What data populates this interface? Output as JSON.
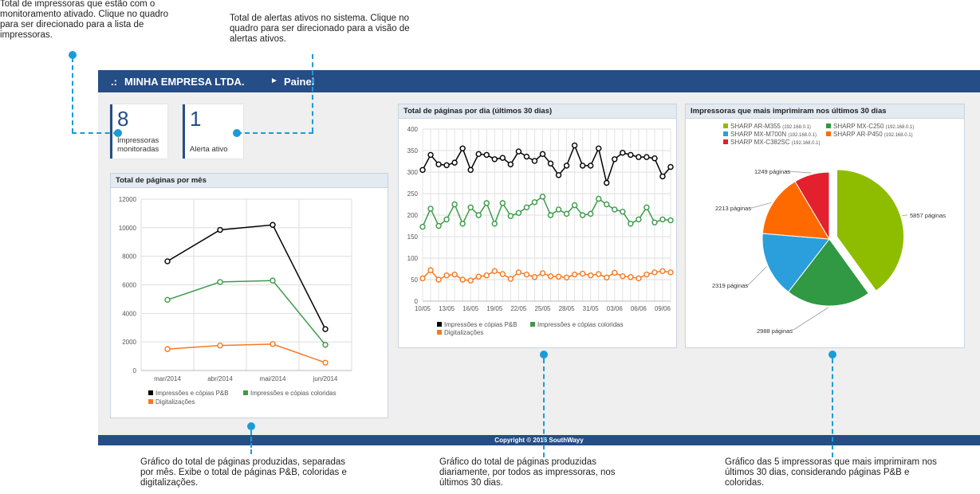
{
  "annotations": {
    "printers": "Total de impressoras que estão com o monitoramento ativado. Clique no quadro para ser direcionado para a lista de impressoras.",
    "alerts": "Total de alertas ativos no sistema. Clique no quadro para ser direcionado para a visão de alertas ativos.",
    "monthly": "Gráfico do total de páginas produzidas, separadas por mês. Exibe o total de páginas P&B, coloridas e digitalizações.",
    "daily": "Gráfico do total de páginas produzidas diariamente, por todos as impressoras, nos últimos 30 dias.",
    "top": "Gráfico das 5 impressoras que mais imprimiram nos últimos 30 dias, considerando páginas P&B e coloridas."
  },
  "header": {
    "prefix": ".:",
    "company": "MINHA EMPRESA LTDA.",
    "arrow": "►",
    "page": "Painel"
  },
  "tiles": {
    "printers": {
      "value": "8",
      "label_line1": "Impressoras",
      "label_line2": "monitoradas"
    },
    "alerts": {
      "value": "1",
      "label": "Alerta ativo"
    }
  },
  "footer": {
    "text": "Copyright © 2016 SouthWayy"
  },
  "colors": {
    "pb": "#000000",
    "color": "#3c9a4a",
    "scan": "#f47a20",
    "header_bg": "#254d86",
    "accent": "#1a9cd8"
  },
  "panels": {
    "monthly_title": "Total de páginas por mês",
    "daily_title": "Total de páginas por dia (últimos 30 dias)",
    "top_title": "Impressoras que mais imprimiram nos últimos 30 dias"
  },
  "chart_data": [
    {
      "type": "line",
      "title": "Total de páginas por mês",
      "categories": [
        "mar/2014",
        "abr/2014",
        "mai/2014",
        "jun/2014"
      ],
      "ylim": [
        0,
        12000
      ],
      "yticks": [
        0,
        2000,
        4000,
        6000,
        8000,
        10000,
        12000
      ],
      "grid": true,
      "legend": "bottom",
      "series": [
        {
          "name": "Impressões e cópias P&B",
          "color": "#000000",
          "values": [
            7650,
            9850,
            10200,
            2900
          ]
        },
        {
          "name": "Impressões e cópias coloridas",
          "color": "#3c9a4a",
          "values": [
            4950,
            6200,
            6300,
            1800
          ]
        },
        {
          "name": "Digitalizações",
          "color": "#f47a20",
          "values": [
            1500,
            1750,
            1850,
            550
          ]
        }
      ]
    },
    {
      "type": "line",
      "title": "Total de páginas por dia (últimos 30 dias)",
      "xticklabels": [
        "10/05",
        "13/05",
        "16/05",
        "19/05",
        "22/05",
        "25/05",
        "28/05",
        "31/05",
        "03/06",
        "06/06",
        "09/06"
      ],
      "ylim": [
        0,
        400
      ],
      "yticks": [
        0,
        50,
        100,
        150,
        200,
        250,
        300,
        350,
        400
      ],
      "grid": true,
      "legend": "bottom",
      "series": [
        {
          "name": "Impressões e cópias P&B",
          "color": "#000000",
          "values": [
            305,
            340,
            318,
            316,
            322,
            355,
            305,
            342,
            340,
            330,
            333,
            318,
            348,
            336,
            326,
            342,
            320,
            293,
            315,
            362,
            315,
            315,
            355,
            275,
            330,
            345,
            340,
            335,
            335,
            332,
            290,
            312
          ]
        },
        {
          "name": "Impressões e cópias coloridas",
          "color": "#3c9a4a",
          "values": [
            173,
            215,
            175,
            190,
            225,
            180,
            218,
            200,
            228,
            180,
            228,
            198,
            205,
            218,
            230,
            243,
            200,
            213,
            203,
            223,
            200,
            203,
            238,
            225,
            213,
            208,
            180,
            190,
            218,
            183,
            190,
            188
          ]
        },
        {
          "name": "Digitalizações",
          "color": "#f47a20",
          "values": [
            53,
            72,
            50,
            60,
            62,
            50,
            48,
            57,
            60,
            70,
            63,
            52,
            67,
            62,
            56,
            65,
            58,
            57,
            55,
            62,
            64,
            60,
            63,
            55,
            66,
            58,
            56,
            53,
            62,
            67,
            70,
            67
          ]
        }
      ]
    },
    {
      "type": "pie",
      "title": "Impressoras que mais imprimiram nos últimos 30 dias",
      "legend": "top",
      "slices": [
        {
          "name": "SHARP AR-M355",
          "ip": "(192.168.0.1)",
          "value": 5857,
          "label": "5857 páginas",
          "color": "#8ebd00"
        },
        {
          "name": "SHARP MX-C250",
          "ip": "(192.168.0.1)",
          "value": 2988,
          "label": "2988 páginas",
          "color": "#319843"
        },
        {
          "name": "SHARP MX-M700N",
          "ip": "(192.168.0.1)",
          "value": 2319,
          "label": "2319 páginas",
          "color": "#2a9fdb"
        },
        {
          "name": "SHARP AR-P450",
          "ip": "(192.168.0.1)",
          "value": 2213,
          "label": "2213 páginas",
          "color": "#ff6a00"
        },
        {
          "name": "SHARP MX-C382SC",
          "ip": "(192.168.0.1)",
          "value": 1249,
          "label": "1249 páginas",
          "color": "#e3202d"
        }
      ]
    }
  ]
}
